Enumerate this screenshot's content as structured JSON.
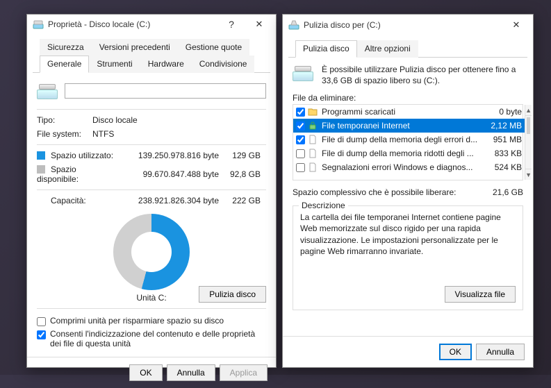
{
  "left": {
    "title": "Proprietà - Disco locale (C:)",
    "tabs_top": [
      "Sicurezza",
      "Versioni precedenti",
      "Gestione quote"
    ],
    "tabs_bottom": [
      "Generale",
      "Strumenti",
      "Hardware",
      "Condivisione"
    ],
    "active_tab": "Generale",
    "name_value": "",
    "type_label": "Tipo:",
    "type_value": "Disco locale",
    "fs_label": "File system:",
    "fs_value": "NTFS",
    "used_label": "Spazio utilizzato:",
    "used_bytes": "139.250.978.816 byte",
    "used_gb": "129 GB",
    "free_label": "Spazio disponibile:",
    "free_bytes": "99.670.847.488 byte",
    "free_gb": "92,8 GB",
    "cap_label": "Capacità:",
    "cap_bytes": "238.921.826.304 byte",
    "cap_gb": "222 GB",
    "drive_caption": "Unità C:",
    "cleanup_btn": "Pulizia disco",
    "compress_label": "Comprimi unità per risparmiare spazio su disco",
    "index_label": "Consenti l'indicizzazione del contenuto e delle proprietà dei file di questa unità",
    "ok": "OK",
    "cancel": "Annulla",
    "apply": "Applica"
  },
  "right": {
    "title": "Pulizia disco per  (C:)",
    "tabs": [
      "Pulizia disco",
      "Altre opzioni"
    ],
    "active_tab": "Pulizia disco",
    "intro": "È possibile utilizzare Pulizia disco per ottenere fino a 33,6 GB di spazio libero su  (C:).",
    "list_label": "File da eliminare:",
    "items": [
      {
        "checked": true,
        "icon": "folder",
        "label": "Programmi scaricati",
        "size": "0 byte"
      },
      {
        "checked": true,
        "icon": "lock",
        "label": "File temporanei Internet",
        "size": "2,12 MB",
        "selected": true
      },
      {
        "checked": true,
        "icon": "file",
        "label": "File di dump della memoria degli errori d...",
        "size": "951 MB"
      },
      {
        "checked": false,
        "icon": "file",
        "label": "File di dump della memoria ridotti degli ...",
        "size": "833 KB"
      },
      {
        "checked": false,
        "icon": "file",
        "label": "Segnalazioni errori Windows e diagnos...",
        "size": "524 KB"
      }
    ],
    "total_label": "Spazio complessivo che è possibile liberare:",
    "total_value": "21,6 GB",
    "desc_title": "Descrizione",
    "desc_text": "La cartella dei file temporanei Internet contiene pagine Web memorizzate sul disco rigido per una rapida visualizzazione. Le impostazioni personalizzate per le pagine Web rimarranno invariate.",
    "view_files": "Visualizza file",
    "ok": "OK",
    "cancel": "Annulla"
  }
}
